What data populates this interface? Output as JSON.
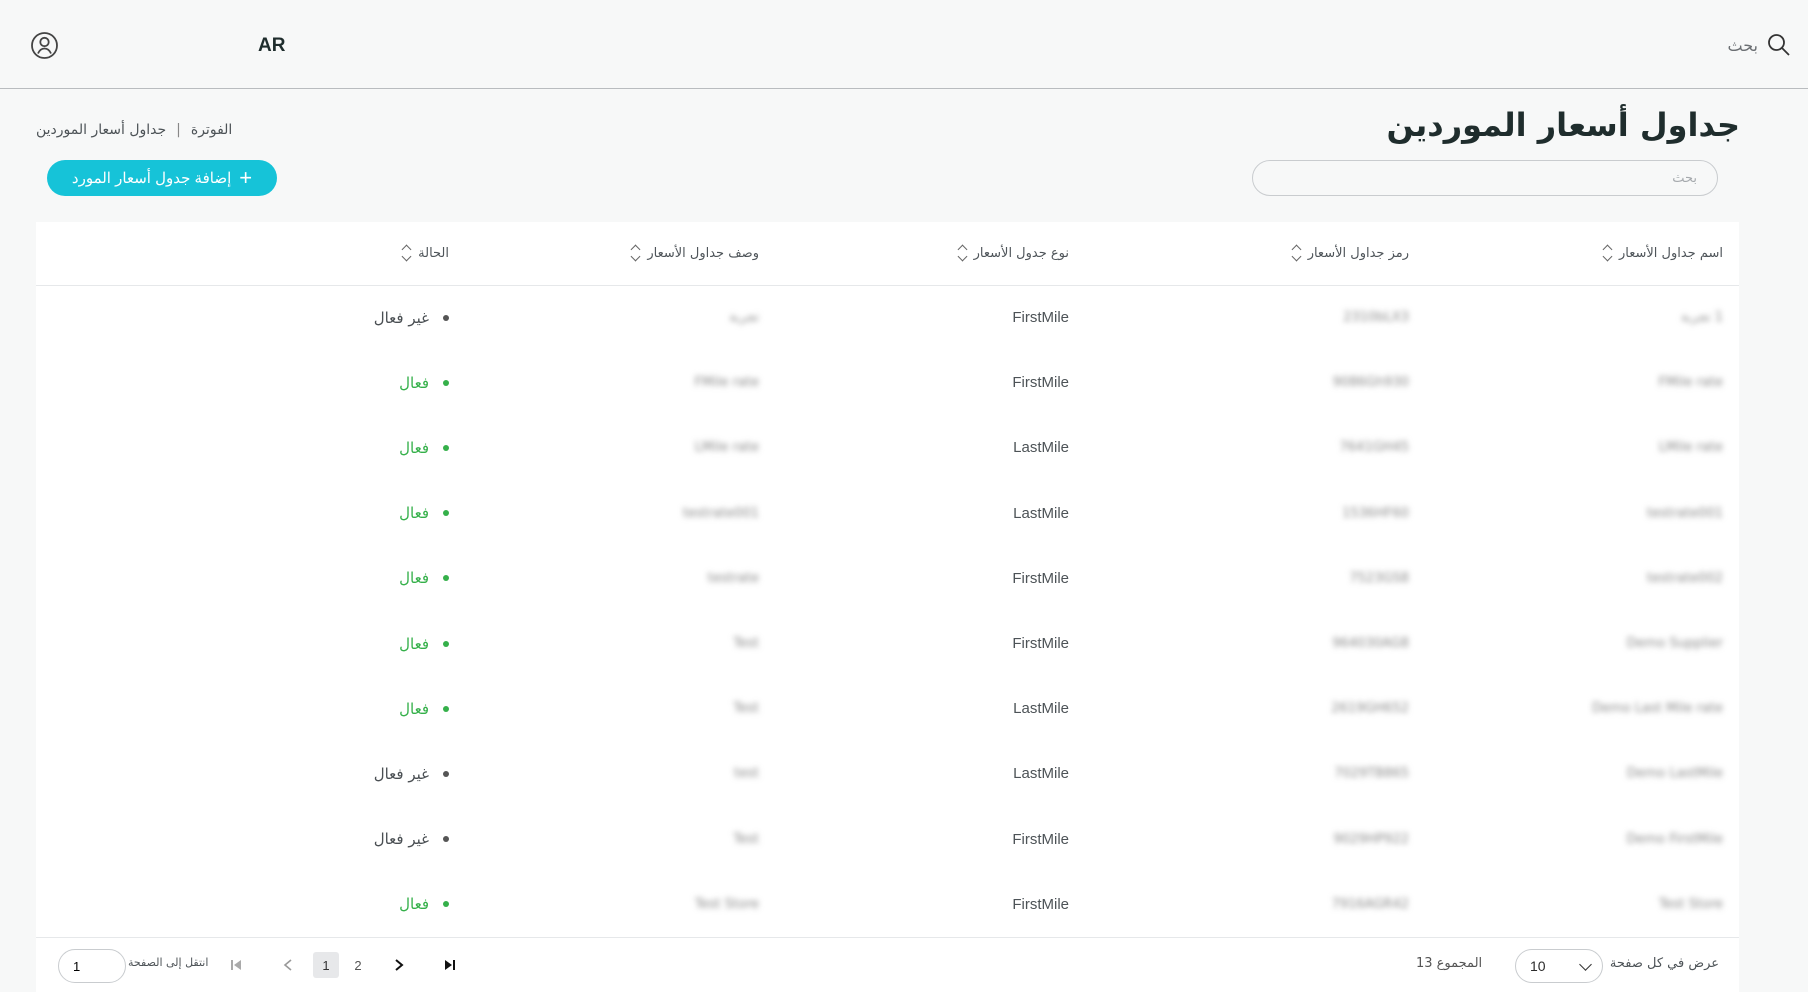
{
  "topbar": {
    "language": "AR",
    "search_label": "بحث"
  },
  "page": {
    "title": "جداول أسعار الموردين",
    "breadcrumb": [
      "الفوترة",
      "جداول أسعار الموردين"
    ],
    "breadcrumb_separator": "|",
    "add_button_label": "إضافة جدول أسعار المورد",
    "search_placeholder": "بحث"
  },
  "table": {
    "columns": [
      "اسم جداول الأسعار",
      "رمز جداول الأسعار",
      "نوع جدول الأسعار",
      "وصف جداول الأسعار",
      "الحالة"
    ],
    "rows": [
      {
        "name": "1 تجربة",
        "code": "2310bLX3",
        "type": "FirstMile",
        "description": "تجربة",
        "status": "غير فعال",
        "active": false
      },
      {
        "name": "FMile rate",
        "code": "9086Gh930",
        "type": "FirstMile",
        "description": "FMile rate",
        "status": "فعال",
        "active": true
      },
      {
        "name": "LMile rate",
        "code": "7641GH45",
        "type": "LastMile",
        "description": "LMile rate",
        "status": "فعال",
        "active": true
      },
      {
        "name": "testrate001",
        "code": "1536HF60",
        "type": "LastMile",
        "description": "testrate001",
        "status": "فعال",
        "active": true
      },
      {
        "name": "testrate002",
        "code": "7523GS8",
        "type": "FirstMile",
        "description": "testrate",
        "status": "فعال",
        "active": true
      },
      {
        "name": "Demo Supplier",
        "code": "964030AG8",
        "type": "FirstMile",
        "description": "Test",
        "status": "فعال",
        "active": true
      },
      {
        "name": "Demo Last Mile rate",
        "code": "2619GH652",
        "type": "LastMile",
        "description": "Test",
        "status": "فعال",
        "active": true
      },
      {
        "name": "Demo LastMile",
        "code": "7029TB865",
        "type": "LastMile",
        "description": "test",
        "status": "غير فعال",
        "active": false
      },
      {
        "name": "Demo FirstMile",
        "code": "9029HP922",
        "type": "FirstMile",
        "description": "Test",
        "status": "غير فعال",
        "active": false
      },
      {
        "name": "Test Store",
        "code": "7916AGR42",
        "type": "FirstMile",
        "description": "Test Store",
        "status": "فعال",
        "active": true
      }
    ]
  },
  "pagination": {
    "per_page_label": "عرض في كل صفحة",
    "per_page_value": "10",
    "total_label": "المجموع 13",
    "pages": [
      "1",
      "2"
    ],
    "current_page": "1",
    "goto_label": "انتقل إلى الصفحة",
    "goto_value": "1"
  },
  "colors": {
    "accent": "#16c3d8",
    "active": "#35b04a",
    "inactive": "#4a4f53"
  }
}
